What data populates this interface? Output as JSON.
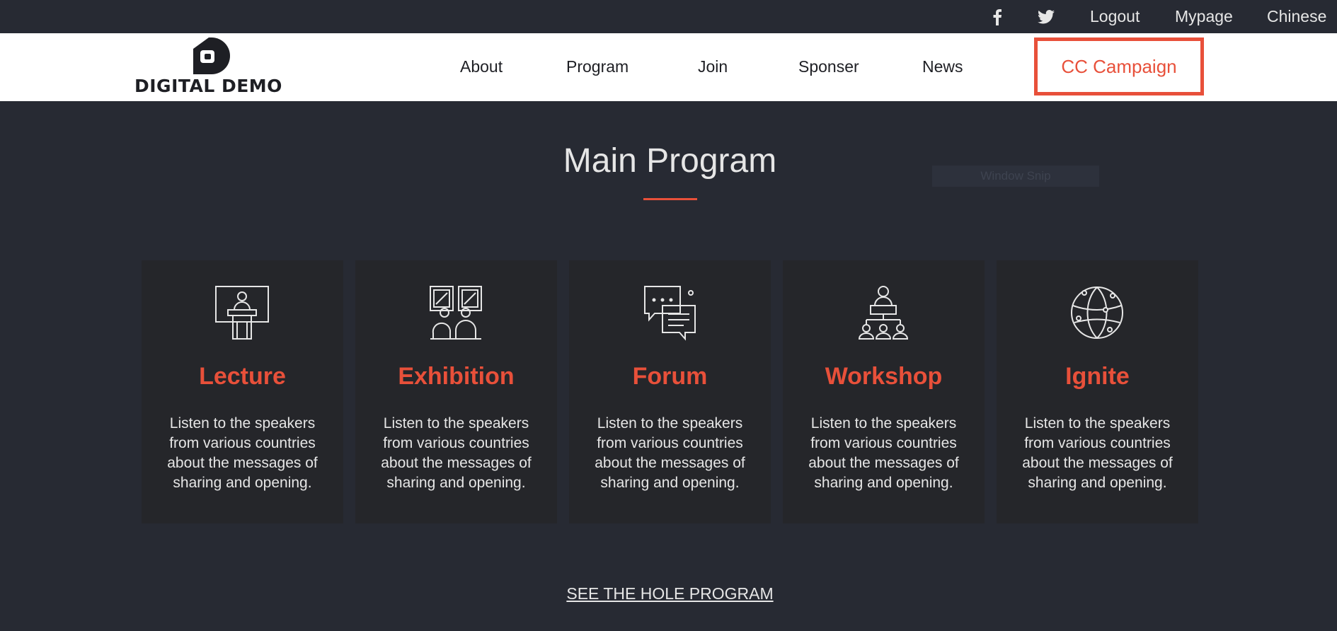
{
  "topbar": {
    "icons": [
      {
        "name": "facebook-icon"
      },
      {
        "name": "twitter-icon"
      }
    ],
    "links": [
      "Logout",
      "Mypage",
      "Chinese"
    ]
  },
  "header": {
    "logo_text": "DIGITAL DEMO",
    "nav": [
      "About",
      "Program",
      "Join",
      "Sponser",
      "News"
    ],
    "cta": "CC Campaign",
    "accent_color": "#e8503a"
  },
  "main": {
    "title": "Main Program",
    "snip_label": "Window Snip",
    "cards": [
      {
        "title": "Lecture",
        "icon": "lecture-icon",
        "desc": "Listen to the speakers from various countries about the messages of sharing and opening."
      },
      {
        "title": "Exhibition",
        "icon": "exhibition-icon",
        "desc": "Listen to the speakers from various countries about the messages of sharing and opening."
      },
      {
        "title": "Forum",
        "icon": "forum-icon",
        "desc": "Listen to the speakers from various countries about the messages of sharing and opening."
      },
      {
        "title": "Workshop",
        "icon": "workshop-icon",
        "desc": "Listen to the speakers from various countries about the messages of sharing and opening."
      },
      {
        "title": "Ignite",
        "icon": "ignite-icon",
        "desc": "Listen to the speakers from various countries about the messages of sharing and opening."
      }
    ],
    "see_program": "SEE THE HOLE PROGRAM"
  }
}
